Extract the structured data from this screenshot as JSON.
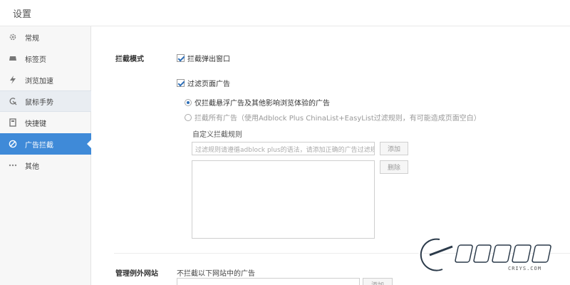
{
  "window": {
    "title": "设置"
  },
  "sidebar": {
    "items": [
      {
        "label": "常规",
        "icon": "gear-icon"
      },
      {
        "label": "标签页",
        "icon": "tab-icon"
      },
      {
        "label": "浏览加速",
        "icon": "lightning-icon"
      },
      {
        "label": "鼠标手势",
        "icon": "mouse-gesture-icon"
      },
      {
        "label": "快捷键",
        "icon": "keyboard-icon"
      },
      {
        "label": "广告拦截",
        "icon": "block-icon"
      },
      {
        "label": "其他",
        "icon": "more-icon"
      }
    ],
    "active_index": 5,
    "hover_index": 3
  },
  "adblock": {
    "section_label": "拦截模式",
    "popup_block_label": "拦截弹出窗口",
    "popup_block_checked": true,
    "filter_ads_label": "过滤页面广告",
    "filter_ads_checked": true,
    "mode_1_label": "仅拦截悬浮广告及其他影响浏览体验的广告",
    "mode_2_label": "拦截所有广告（使用Adblock Plus ChinaList+EasyList过滤规则，有可能造成页面空白）",
    "custom_rules_label": "自定义拦截规则",
    "rule_input_placeholder": "过滤规则请遵循adblock plus的语法，请添加正确的广告过滤规则",
    "add_label": "添加",
    "delete_label": "删除"
  },
  "exceptions": {
    "section_label": "管理例外网站",
    "desc": "不拦截以下网站中的广告",
    "add_label": "添加"
  },
  "watermark": {
    "logo_text": "CRIYS.COM"
  },
  "colors": {
    "accent": "#3f8ad8",
    "sidebar_bg": "#f7f7f7"
  }
}
